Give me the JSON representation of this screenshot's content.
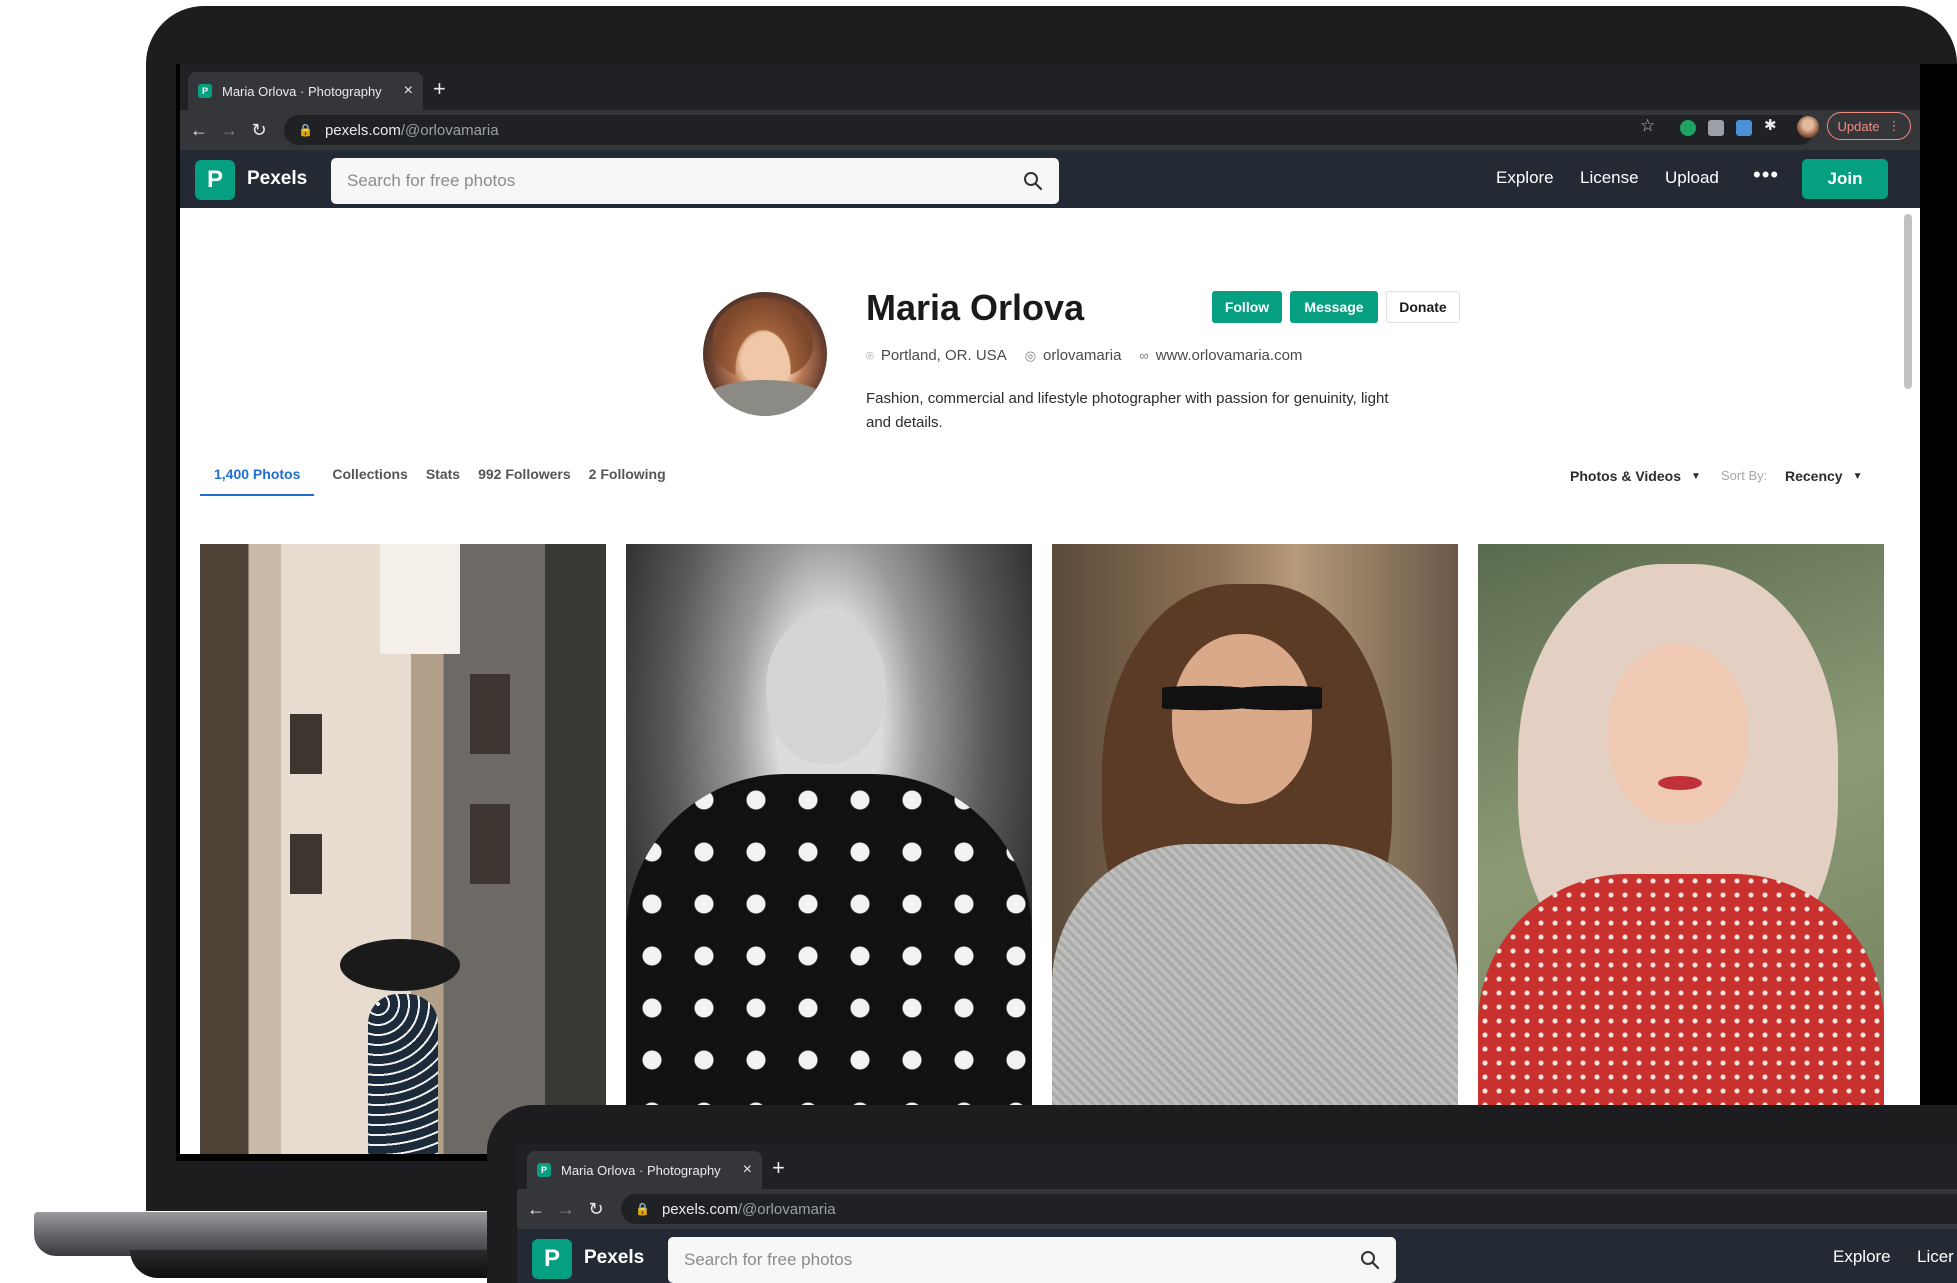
{
  "browser": {
    "tab_title": "Maria Orlova · Photography",
    "tab_close": "×",
    "new_tab": "+",
    "url_host": "pexels.com",
    "url_path": "/@orlovamaria",
    "update_label": "Update",
    "back": "←",
    "forward": "→",
    "reload": "↻",
    "star": "☆",
    "menu": "⋮"
  },
  "header": {
    "logo_letter": "P",
    "brand": "Pexels",
    "search_placeholder": "Search for free photos",
    "nav": [
      "Explore",
      "License",
      "Upload"
    ],
    "more": "•••",
    "join_label": "Join"
  },
  "profile": {
    "name": "Maria Orlova",
    "follow_label": "Follow",
    "message_label": "Message",
    "donate_label": "Donate",
    "location": "Portland, OR. USA",
    "instagram": "orlovamaria",
    "website": "www.orlovamaria.com",
    "bio": "Fashion, commercial and lifestyle photographer with passion for genuinity, light and details."
  },
  "tabs": [
    "1,400 Photos",
    "Collections",
    "Stats",
    "992 Followers",
    "2 Following"
  ],
  "filters": {
    "media_label": "Photos & Videos",
    "sort_by_label": "Sort By:",
    "sort_value": "Recency"
  },
  "front_header": {
    "nav_visible": [
      "Explore",
      "Licer"
    ]
  },
  "colors": {
    "brand": "#05a081",
    "header_bg": "#232a34",
    "active_tab": "#1f6fd1"
  }
}
